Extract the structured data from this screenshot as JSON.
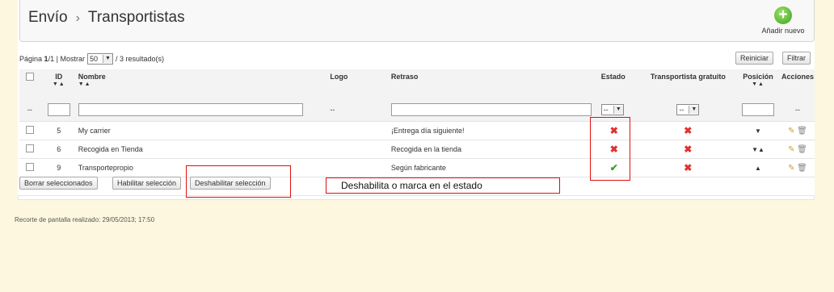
{
  "breadcrumb": {
    "section": "Envío",
    "page": "Transportistas"
  },
  "add_button": {
    "label": "Añadir nuevo"
  },
  "pagination": {
    "page_prefix": "Página",
    "current": "1",
    "separator": " / ",
    "total": "1",
    "show_label": "| Mostrar",
    "page_size": "50",
    "results": "/ 3 resultado(s)"
  },
  "actions": {
    "reset": "Reiniciar",
    "filter": "Filtrar"
  },
  "columns": {
    "id": "ID",
    "name": "Nombre",
    "logo": "Logo",
    "delay": "Retraso",
    "status": "Estado",
    "free": "Transportista gratuito",
    "position": "Posición",
    "actions": "Acciones"
  },
  "filter": {
    "placeholder_dash": "--",
    "status_value": "--",
    "free_value": "--"
  },
  "rows": [
    {
      "id": "5",
      "name": "My carrier",
      "delay": "¡Entrega día siguiente!",
      "status": "disabled",
      "free": "no",
      "position": "down"
    },
    {
      "id": "6",
      "name": "Recogida en Tienda",
      "delay": "Recogida en la tienda",
      "status": "disabled",
      "free": "no",
      "position": "both"
    },
    {
      "id": "9",
      "name": "Transportepropio",
      "delay": "Según fabricante",
      "status": "enabled",
      "free": "no",
      "position": "up"
    }
  ],
  "bulk": {
    "delete": "Borrar seleccionados",
    "enable": "Habilitar selección",
    "disable": "Deshabilitar selección"
  },
  "annotation": "Deshabilita o marca en el estado",
  "capture_note": "Recorte de pantalla realizado: 29/05/2013; 17:50",
  "colors": {
    "annotation_border": "#e01010",
    "enabled": "#3a9e2c",
    "disabled": "#e03030",
    "background": "#fdf7df"
  }
}
